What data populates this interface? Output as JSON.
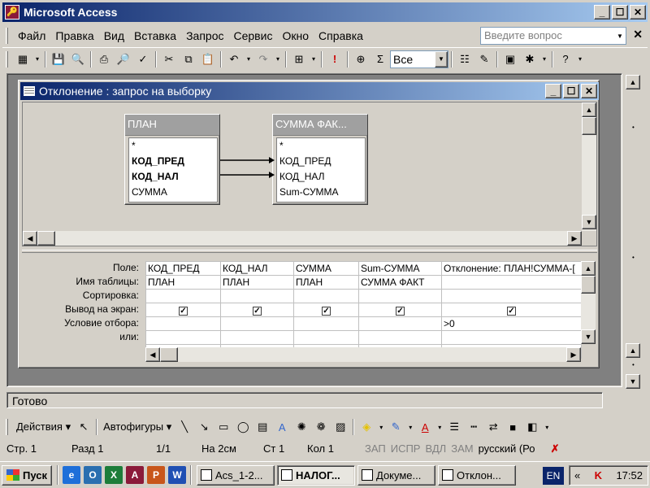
{
  "app": {
    "title": "Microsoft Access",
    "icon": "access-key-icon"
  },
  "menu": {
    "items": [
      "Файл",
      "Правка",
      "Вид",
      "Вставка",
      "Запрос",
      "Сервис",
      "Окно",
      "Справка"
    ],
    "help_placeholder": "Введите вопрос"
  },
  "toolbar": {
    "top_values_select": "Все"
  },
  "query_window": {
    "title": "Отклонение : запрос на выборку",
    "tables": [
      {
        "name": "ПЛАН",
        "fields": [
          "*",
          "КОД_ПРЕД",
          "КОД_НАЛ",
          "СУММА"
        ]
      },
      {
        "name": "СУММА ФАК...",
        "fields": [
          "*",
          "КОД_ПРЕД",
          "КОД_НАЛ",
          "Sum-СУММА"
        ]
      }
    ],
    "row_labels": [
      "Поле:",
      "Имя таблицы:",
      "Сортировка:",
      "Вывод на экран:",
      "Условие отбора:",
      "или:"
    ],
    "columns": [
      {
        "field": "КОД_ПРЕД",
        "table": "ПЛАН",
        "sort": "",
        "show": true,
        "criteria": "",
        "or": ""
      },
      {
        "field": "КОД_НАЛ",
        "table": "ПЛАН",
        "sort": "",
        "show": true,
        "criteria": "",
        "or": ""
      },
      {
        "field": "СУММА",
        "table": "ПЛАН",
        "sort": "",
        "show": true,
        "criteria": "",
        "or": ""
      },
      {
        "field": "Sum-СУММА",
        "table": "СУММА ФАКТ",
        "sort": "",
        "show": true,
        "criteria": "",
        "or": ""
      },
      {
        "field": "Отклонение: ПЛАН!СУММА-[",
        "table": "",
        "sort": "",
        "show": true,
        "criteria": ">0",
        "or": ""
      }
    ]
  },
  "status": {
    "ready": "Готово"
  },
  "drawing_toolbar": {
    "actions_label": "Действия",
    "autoshapes_label": "Автофигуры"
  },
  "statusbar": {
    "page": "Стр. 1",
    "section": "Разд 1",
    "pages": "1/1",
    "position": "На 2см",
    "line": "Ст 1",
    "column": "Кол 1",
    "rec": "ЗАП",
    "trk": "ИСПР",
    "ext": "ВДЛ",
    "ovr": "ЗАМ",
    "language": "русский (Ро"
  },
  "taskbar": {
    "start_label": "Пуск",
    "tasks": [
      "Acs_1-2...",
      "НАЛОГ...",
      "Докуме...",
      "Отклон..."
    ],
    "active_task": 1,
    "lang": "EN",
    "clock": "17:52"
  }
}
